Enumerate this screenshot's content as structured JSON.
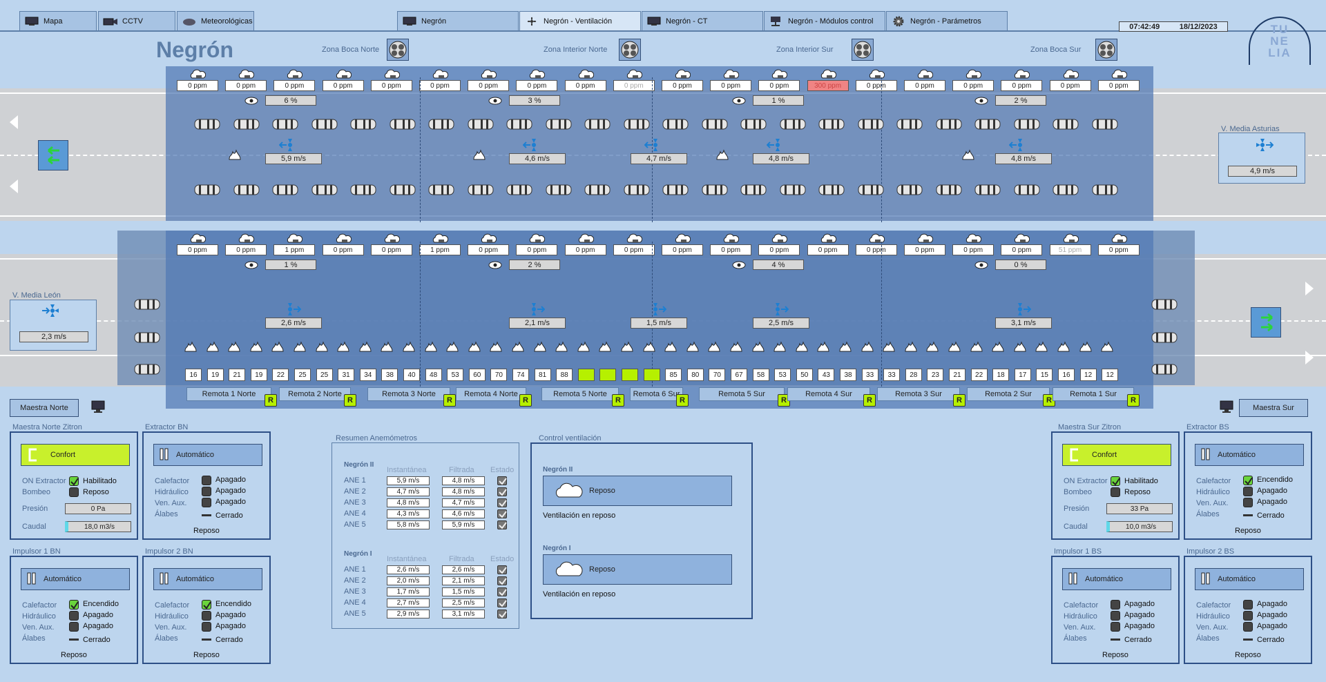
{
  "tabs": [
    {
      "label": "Mapa",
      "icon": "monitor-icon"
    },
    {
      "label": "CCTV",
      "icon": "camera-icon"
    },
    {
      "label": "Meteorológicas",
      "icon": "weather-icon"
    },
    {
      "label": "Negrón",
      "icon": "monitor-icon"
    },
    {
      "label": "Negrón - Ventilación",
      "icon": "fan-icon"
    },
    {
      "label": "Negrón - CT",
      "icon": "monitor-icon"
    },
    {
      "label": "Negrón - Módulos control",
      "icon": "module-icon"
    },
    {
      "label": "Negrón - Parámetros",
      "icon": "gear-icon"
    }
  ],
  "clock": {
    "time": "07:42:49",
    "date": "18/12/2023"
  },
  "logo": {
    "line1": "TU",
    "line2": "NE",
    "line3": "LIA"
  },
  "title": "Negrón",
  "zones": [
    "Zona Boca Norte",
    "Zona Interior Norte",
    "Zona Interior Sur",
    "Zona Boca Sur"
  ],
  "tube1": {
    "ppm": [
      "0 ppm",
      "0 ppm",
      "0 ppm",
      "0 ppm",
      "0 ppm",
      "0 ppm",
      "0 ppm",
      "0 ppm",
      "0 ppm",
      "0 ppm",
      "0 ppm",
      "0 ppm",
      "0 ppm",
      "300 ppm",
      "0 ppm",
      "0 ppm",
      "0 ppm",
      "0 ppm",
      "0 ppm",
      "0 ppm"
    ],
    "opacity": [
      "6 %",
      "3 %",
      "1 %",
      "2 %"
    ],
    "speeds": [
      "5,9 m/s",
      "4,6 m/s",
      "4,7 m/s",
      "4,8 m/s",
      "4,8 m/s"
    ]
  },
  "tube2": {
    "ppm": [
      "0 ppm",
      "0 ppm",
      "1 ppm",
      "0 ppm",
      "0 ppm",
      "1 ppm",
      "0 ppm",
      "0 ppm",
      "0 ppm",
      "0 ppm",
      "0 ppm",
      "0 ppm",
      "0 ppm",
      "0 ppm",
      "0 ppm",
      "0 ppm",
      "0 ppm",
      "0 ppm",
      "51 ppm",
      "0 ppm"
    ],
    "opacity": [
      "1 %",
      "2 %",
      "4 %",
      "0 %"
    ],
    "speeds": [
      "2,6 m/s",
      "2,1 m/s",
      "1,5 m/s",
      "2,5 m/s",
      "3,1 m/s"
    ]
  },
  "vmedia_asturias": {
    "label": "V. Media Asturias",
    "value": "4,9 m/s"
  },
  "vmedia_leon": {
    "label": "V. Media León",
    "value": "2,3 m/s"
  },
  "counters": [
    "16",
    "19",
    "21",
    "19",
    "22",
    "25",
    "25",
    "31",
    "34",
    "38",
    "40",
    "48",
    "53",
    "60",
    "70",
    "74",
    "81",
    "88",
    "",
    "",
    "",
    "",
    "85",
    "80",
    "70",
    "67",
    "58",
    "53",
    "50",
    "43",
    "38",
    "33",
    "33",
    "28",
    "23",
    "21",
    "22",
    "18",
    "17",
    "15",
    "16",
    "12",
    "12"
  ],
  "remotas": [
    {
      "label": "Remota 1 Norte",
      "r": "R"
    },
    {
      "label": "Remota 2 Norte",
      "r": "R"
    },
    {
      "label": "Remota 3 Norte",
      "r": "R"
    },
    {
      "label": "Remota 4 Norte",
      "r": "R"
    },
    {
      "label": "Remota 5 Norte",
      "r": "R"
    },
    {
      "label": "Remota 6 Sur",
      "r": "R"
    },
    {
      "label": "Remota 5 Sur",
      "r": "R"
    },
    {
      "label": "Remota 4 Sur",
      "r": "R"
    },
    {
      "label": "Remota 3 Sur",
      "r": "R"
    },
    {
      "label": "Remota 2 Sur",
      "r": "R"
    },
    {
      "label": "Remota 1 Sur",
      "r": "R"
    }
  ],
  "maestra_norte_btn": "Maestra Norte",
  "maestra_sur_btn": "Maestra Sur",
  "mn": {
    "title": "Maestra Norte Zitron",
    "mode": "Confort",
    "l1": "ON Extractor",
    "v1": "Habilitado",
    "l2": "Bombeo",
    "v2": "Reposo",
    "l3": "Presión",
    "v3": "0 Pa",
    "l4": "Caudal",
    "v4": "18,0 m3/s"
  },
  "ms": {
    "title": "Maestra Sur Zitron",
    "mode": "Confort",
    "l1": "ON Extractor",
    "v1": "Habilitado",
    "l2": "Bombeo",
    "v2": "Reposo",
    "l3": "Presión",
    "v3": "33 Pa",
    "l4": "Caudal",
    "v4": "10,0 m3/s"
  },
  "equip": [
    {
      "title": "Extractor BN",
      "mode": "Automático",
      "v1": "Apagado",
      "v2": "Apagado",
      "v3": "Apagado",
      "v4": "Cerrado",
      "status": "Reposo"
    },
    {
      "title": "Impulsor 1 BN",
      "mode": "Automático",
      "v1": "Encendido",
      "v2": "Apagado",
      "v3": "Apagado",
      "v4": "Cerrado",
      "status": "Reposo"
    },
    {
      "title": "Impulsor 2 BN",
      "mode": "Automático",
      "v1": "Encendido",
      "v2": "Apagado",
      "v3": "Apagado",
      "v4": "Cerrado",
      "status": "Reposo"
    },
    {
      "title": "Extractor BS",
      "mode": "Automático",
      "v1": "Encendido",
      "v2": "Apagado",
      "v3": "Apagado",
      "v4": "Cerrado",
      "status": "Reposo"
    },
    {
      "title": "Impulsor 1 BS",
      "mode": "Automático",
      "v1": "Apagado",
      "v2": "Apagado",
      "v3": "Apagado",
      "v4": "Cerrado",
      "status": "Reposo"
    },
    {
      "title": "Impulsor 2 BS",
      "mode": "Automático",
      "v1": "Apagado",
      "v2": "Apagado",
      "v3": "Apagado",
      "v4": "Cerrado",
      "status": "Reposo"
    }
  ],
  "equip_labels": {
    "l1": "Calefactor",
    "l2": "Hidráulico",
    "l3": "Ven. Aux.",
    "l4": "Álabes"
  },
  "anem": {
    "title": "Resumen Anemómetros",
    "col1": "Instantánea",
    "col2": "Filtrada",
    "col3": "Estado",
    "groups": [
      {
        "name": "Negrón II",
        "rows": [
          {
            "n": "ANE 1",
            "i": "5,9 m/s",
            "f": "4,8 m/s"
          },
          {
            "n": "ANE 2",
            "i": "4,7 m/s",
            "f": "4,8 m/s"
          },
          {
            "n": "ANE 3",
            "i": "4,8 m/s",
            "f": "4,7 m/s"
          },
          {
            "n": "ANE 4",
            "i": "4,3 m/s",
            "f": "4,6 m/s"
          },
          {
            "n": "ANE 5",
            "i": "5,8 m/s",
            "f": "5,9 m/s"
          }
        ]
      },
      {
        "name": "Negrón I",
        "rows": [
          {
            "n": "ANE 1",
            "i": "2,6 m/s",
            "f": "2,6 m/s"
          },
          {
            "n": "ANE 2",
            "i": "2,0 m/s",
            "f": "2,1 m/s"
          },
          {
            "n": "ANE 3",
            "i": "1,7 m/s",
            "f": "1,5 m/s"
          },
          {
            "n": "ANE 4",
            "i": "2,7 m/s",
            "f": "2,5 m/s"
          },
          {
            "n": "ANE 5",
            "i": "2,9 m/s",
            "f": "3,1 m/s"
          }
        ]
      }
    ]
  },
  "control": {
    "title": "Control ventilación",
    "g1": "Negrón II",
    "b1": "Reposo",
    "s1": "Ventilación en reposo",
    "g2": "Negrón I",
    "b2": "Reposo",
    "s2": "Ventilación en reposo"
  }
}
